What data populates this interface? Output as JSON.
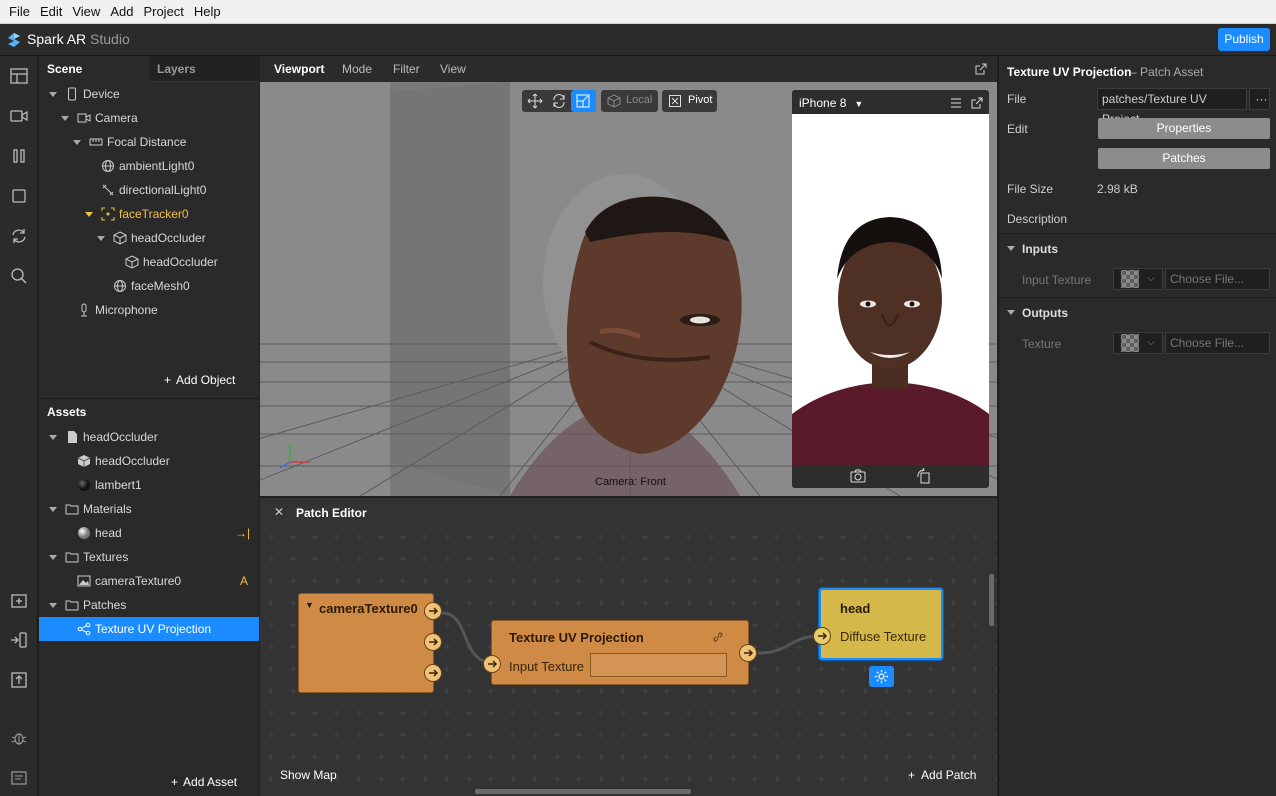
{
  "menu": [
    "File",
    "Edit",
    "View",
    "Add",
    "Project",
    "Help"
  ],
  "app": {
    "title_main": "Spark AR",
    "title_sub": " Studio",
    "publish_label": "Publish"
  },
  "scene": {
    "tabs": [
      "Scene",
      "Layers"
    ],
    "items": [
      {
        "label": "Device"
      },
      {
        "label": "Camera"
      },
      {
        "label": "Focal Distance"
      },
      {
        "label": "ambientLight0"
      },
      {
        "label": "directionalLight0"
      },
      {
        "label": "faceTracker0"
      },
      {
        "label": "headOccluder"
      },
      {
        "label": "headOccluder"
      },
      {
        "label": "faceMesh0"
      },
      {
        "label": "Microphone"
      }
    ],
    "add_object": "Add Object"
  },
  "assets": {
    "title": "Assets",
    "items": [
      {
        "label": "headOccluder"
      },
      {
        "label": "headOccluder"
      },
      {
        "label": "lambert1"
      },
      {
        "label": "Materials"
      },
      {
        "label": "head",
        "badge": "→|"
      },
      {
        "label": "Textures"
      },
      {
        "label": "cameraTexture0",
        "badge": "A"
      },
      {
        "label": "Patches"
      },
      {
        "label": "Texture UV Projection"
      }
    ],
    "add_asset": "Add Asset"
  },
  "viewport": {
    "tabs": [
      "Viewport",
      "Mode",
      "Filter",
      "View"
    ],
    "local_label": "Local",
    "pivot_label": "Pivot",
    "device": "iPhone 8",
    "camera_label": "Camera: Front"
  },
  "patch_editor": {
    "title": "Patch Editor",
    "show_map": "Show Map",
    "add_patch": "Add Patch",
    "nodes": {
      "camera": {
        "title": "cameraTexture0"
      },
      "uv": {
        "title": "Texture UV Projection",
        "input_label": "Input Texture"
      },
      "head": {
        "title": "head",
        "input_label": "Diffuse Texture"
      }
    }
  },
  "inspector": {
    "title": "Texture UV Projection",
    "subtitle": "– Patch Asset",
    "file_label": "File",
    "file_value": "patches/Texture UV Project...",
    "file_more": "···",
    "edit_label": "Edit",
    "properties_btn": "Properties",
    "patches_btn": "Patches",
    "file_size_label": "File Size",
    "file_size_value": "2.98 kB",
    "description_label": "Description",
    "inputs_header": "Inputs",
    "input_texture_label": "Input Texture",
    "input_choose": "Choose File...",
    "outputs_header": "Outputs",
    "output_texture_label": "Texture",
    "output_choose": "Choose File..."
  },
  "colors": {
    "accent": "#1a8cff",
    "node_orange": "#cf8b45",
    "node_yellow": "#d4b84a",
    "selection_yellow": "#f0c040"
  }
}
